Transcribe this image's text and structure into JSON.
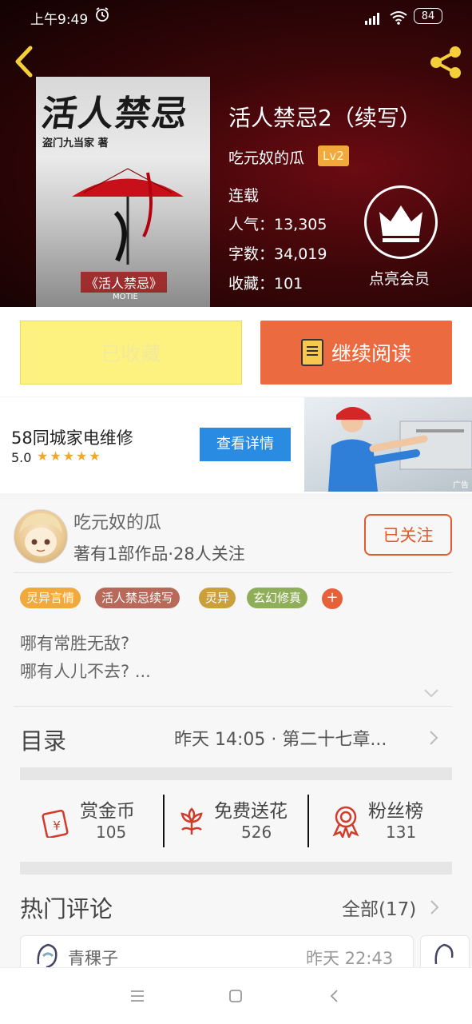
{
  "status": {
    "time": "上午9:49",
    "battery": "84"
  },
  "book": {
    "title": "活人禁忌2（续写）",
    "author": "吃元奴的瓜",
    "level": "Lv2",
    "state": "连载",
    "popularity": "人气：13,305",
    "word_count": "字数：34,019",
    "collections": "收藏：101",
    "vip_label": "点亮会员",
    "cover": {
      "title": "活人禁忌",
      "author": "盗门九当家 著",
      "subtitle": "《活人禁忌》",
      "brand": "MOTIE"
    }
  },
  "actions": {
    "collect": "已收藏",
    "read": "继续阅读"
  },
  "ad": {
    "title": "58同城家电维修",
    "rating": "5.0",
    "stars": "★★★★★",
    "button": "查看详情",
    "close": "✕",
    "label": "广告"
  },
  "author_card": {
    "name": "吃元奴的瓜",
    "meta": "著有1部作品·28人关注",
    "follow": "已关注"
  },
  "tags": [
    {
      "label": "灵异言情",
      "color": "#f2a93b"
    },
    {
      "label": "活人禁忌续写",
      "color": "#b86a5a"
    },
    {
      "label": "灵异",
      "color": "#c9a03c"
    },
    {
      "label": "玄幻修真",
      "color": "#8fae5a"
    }
  ],
  "tag_add": "+",
  "intro": [
    "哪有常胜无敌?",
    "哪有人儿不去? ..."
  ],
  "toc": {
    "label": "目录",
    "latest": "昨天 14:05 · 第二十七章..."
  },
  "stats": [
    {
      "label": "赏金币",
      "value": "105",
      "icon": "red-envelope-icon"
    },
    {
      "label": "免费送花",
      "value": "526",
      "icon": "flower-icon"
    },
    {
      "label": "粉丝榜",
      "value": "131",
      "icon": "medal-icon"
    }
  ],
  "comments": {
    "label": "热门评论",
    "all": "全部(17)",
    "first_user": "青稞子",
    "first_time": "昨天 22:43"
  },
  "colors": {
    "accent": "#ec6a3f",
    "collect_bg": "#fdf27f",
    "ad_button": "#2a8be3",
    "follow": "#e05a2e"
  }
}
